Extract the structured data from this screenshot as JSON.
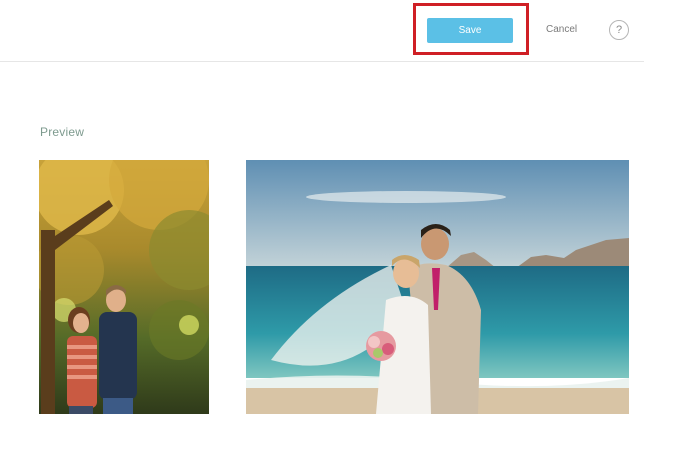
{
  "toolbar": {
    "save_label": "Save",
    "cancel_label": "Cancel",
    "help_label": "?"
  },
  "preview": {
    "label": "Preview",
    "images": [
      {
        "name": "autumn-couple-portrait-photo"
      },
      {
        "name": "beach-wedding-couple-photo"
      }
    ]
  },
  "colors": {
    "save_button": "#5bc0e6",
    "highlight_frame": "#cf1f25",
    "preview_label": "#7d9a8e"
  }
}
